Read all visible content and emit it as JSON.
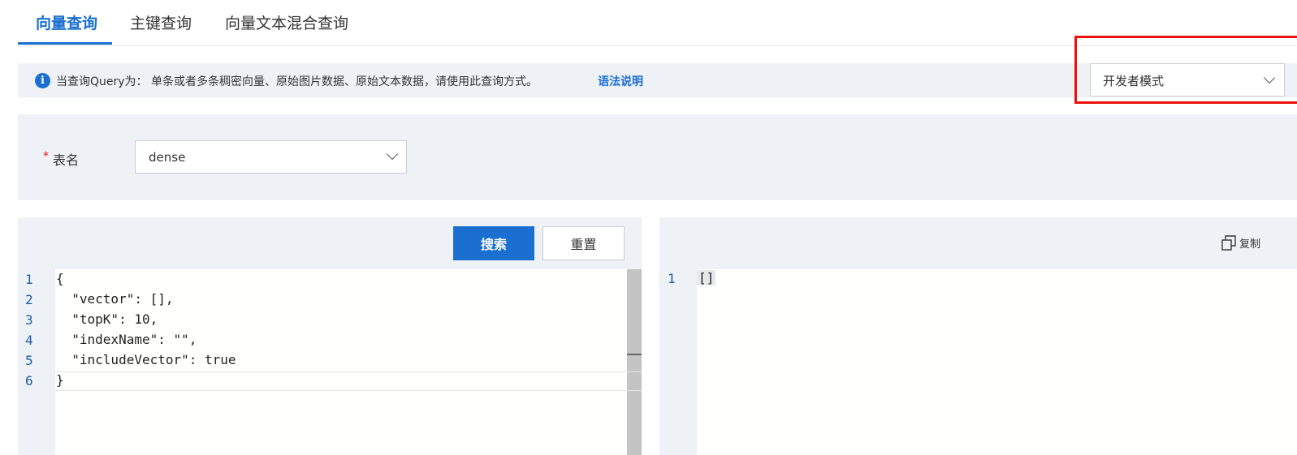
{
  "tabs": [
    {
      "label": "向量查询",
      "active": true
    },
    {
      "label": "主键查询",
      "active": false
    },
    {
      "label": "向量文本混合查询",
      "active": false
    }
  ],
  "info": {
    "text": "当查询Query为： 单条或者多条稠密向量、原始图片数据、原始文本数据，请使用此查询方式。",
    "link": "语法说明",
    "icon": "info-icon"
  },
  "mode_select": {
    "value": "开发者模式"
  },
  "form": {
    "table_label": "表名",
    "required_mark": "*",
    "table_value": "dense"
  },
  "buttons": {
    "search": "搜索",
    "reset": "重置",
    "copy": "复制"
  },
  "editor": {
    "line_numbers": [
      "1",
      "2",
      "3",
      "4",
      "5",
      "6"
    ],
    "lines": [
      "{",
      "  \"vector\": [],",
      "  \"topK\": 10,",
      "  \"indexName\": \"\",",
      "  \"includeVector\": true",
      "}"
    ]
  },
  "result": {
    "line_numbers": [
      "1"
    ],
    "lines": [
      "[]"
    ]
  },
  "colors": {
    "accent": "#1a6fd1",
    "highlight": "#e8110f",
    "panel_bg": "#eef1f6"
  }
}
